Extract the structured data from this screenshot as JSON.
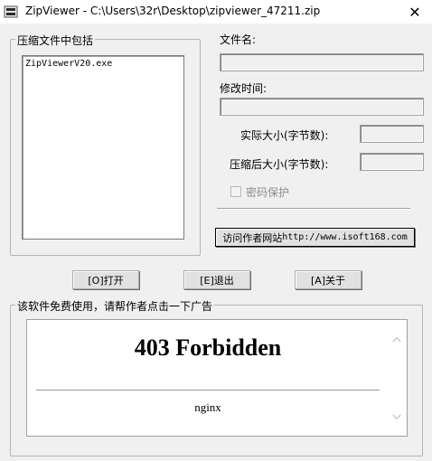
{
  "window": {
    "title": "ZipViewer - C:\\Users\\32r\\Desktop\\zipviewer_47211.zip",
    "close_glyph": "✕"
  },
  "zip_contents": {
    "label": "压缩文件中包括",
    "items": [
      "ZipViewerV20.exe"
    ]
  },
  "details": {
    "filename_label": "文件名:",
    "filename_value": "",
    "modified_label": "修改时间:",
    "modified_value": "",
    "actual_size_label": "实际大小(字节数):",
    "actual_size_value": "",
    "compressed_size_label": "压缩后大小(字节数):",
    "compressed_size_value": "",
    "password_label": "密码保护",
    "password_checked": false
  },
  "buttons": {
    "author_site": "访问作者网站",
    "author_site_url": "http://www.isoft168.com",
    "open": "[O]打开",
    "exit": "[E]退出",
    "about": "[A]关于"
  },
  "ad": {
    "label": "该软件免费使用，请帮作者点击一下广告",
    "heading": "403 Forbidden",
    "server": "nginx"
  }
}
